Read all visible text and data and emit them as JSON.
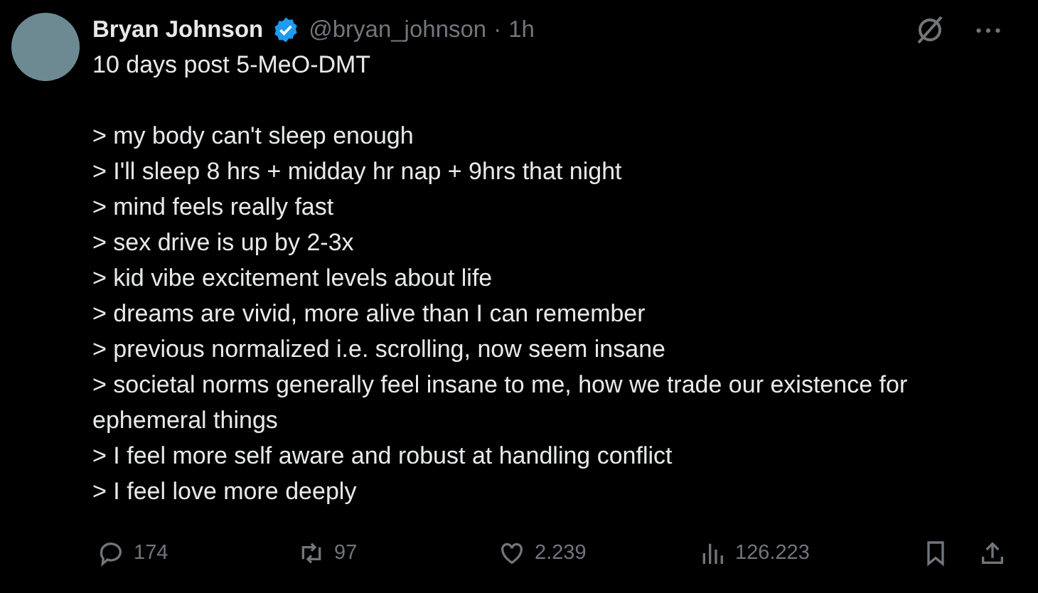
{
  "author": {
    "name": "Bryan Johnson",
    "verified": true,
    "handle": "@bryan_johnson",
    "separator": "·",
    "time": "1h"
  },
  "text": {
    "headline": "10 days post 5-MeO-DMT",
    "lines": [
      "> my body can't sleep enough",
      "> I'll sleep 8 hrs + midday hr nap + 9hrs that night",
      "> mind feels really fast",
      "> sex drive is up by 2-3x",
      "> kid vibe excitement levels about life",
      "> dreams are vivid, more alive than I can remember",
      "> previous normalized i.e. scrolling, now seem insane",
      "> societal norms generally feel insane to me, how we trade our existence for ephemeral things",
      "> I feel more self aware and robust at handling conflict",
      "> I feel love more deeply"
    ]
  },
  "actions": [
    {
      "kind": "reply",
      "count": "174"
    },
    {
      "kind": "repost",
      "count": "97"
    },
    {
      "kind": "like",
      "count": "2.239"
    },
    {
      "kind": "views",
      "count": "126.223"
    },
    {
      "kind": "bookmark"
    },
    {
      "kind": "share"
    }
  ]
}
